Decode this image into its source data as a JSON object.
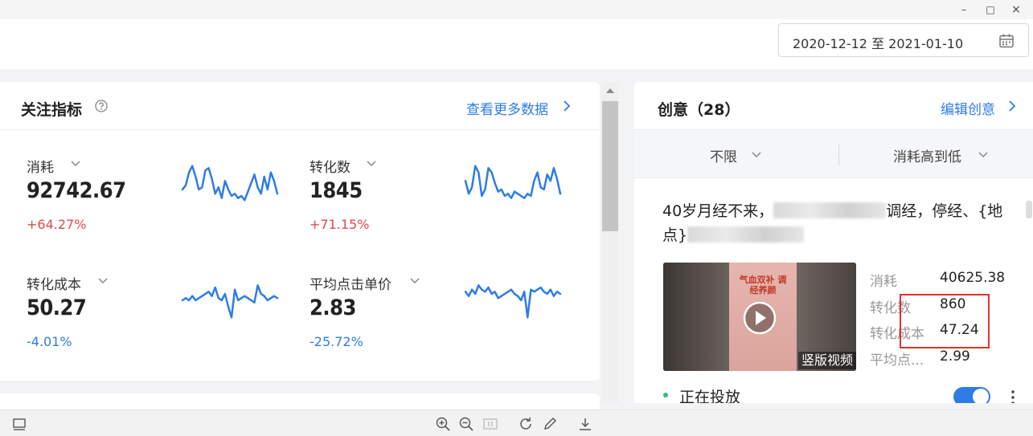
{
  "window": {
    "minimize_glyph": "–",
    "maximize_glyph": "□",
    "close_glyph": "×"
  },
  "header": {
    "date_range": "2020-12-12 至 2021-01-10",
    "calendar_icon": "calendar-icon"
  },
  "focus": {
    "title": "关注指标",
    "help_icon": "question-circle-icon",
    "more_link": "查看更多数据",
    "metrics": [
      {
        "label": "消耗",
        "value": "92742.67",
        "change": "+64.27%",
        "trend": "up",
        "spark": [
          30,
          26,
          14,
          8,
          18,
          30,
          28,
          12,
          10,
          20,
          34,
          28,
          38,
          22,
          30,
          36,
          34,
          38,
          36,
          40,
          32,
          24,
          16,
          28,
          34,
          18,
          30,
          14,
          22,
          34
        ]
      },
      {
        "label": "转化数",
        "value": "1845",
        "change": "+71.15%",
        "trend": "up",
        "spark": [
          22,
          34,
          28,
          8,
          14,
          36,
          30,
          10,
          14,
          24,
          32,
          30,
          36,
          34,
          38,
          32,
          34,
          36,
          38,
          34,
          36,
          22,
          14,
          28,
          30,
          16,
          22,
          10,
          20,
          34
        ]
      },
      {
        "label": "转化成本",
        "value": "50.27",
        "change": "-4.01%",
        "trend": "down",
        "spark": [
          24,
          22,
          24,
          20,
          24,
          22,
          20,
          18,
          16,
          20,
          12,
          22,
          24,
          18,
          30,
          40,
          14,
          24,
          22,
          20,
          22,
          24,
          26,
          10,
          18,
          20,
          24,
          22,
          20,
          22
        ]
      },
      {
        "label": "平均点击单价",
        "value": "2.83",
        "change": "-25.72%",
        "trend": "down",
        "spark": [
          16,
          20,
          14,
          18,
          10,
          14,
          16,
          12,
          18,
          16,
          22,
          20,
          18,
          16,
          14,
          18,
          20,
          24,
          16,
          40,
          14,
          16,
          14,
          12,
          16,
          18,
          14,
          20,
          16,
          18
        ]
      }
    ]
  },
  "creative": {
    "title": "创意（28）",
    "edit_link": "编辑创意",
    "filters": {
      "scope": "不限",
      "sort": "消耗高到低"
    },
    "ad": {
      "title_start": "40岁月经不来，",
      "title_mid": "调经，停经、{地",
      "title_line2_start": "点}",
      "thumbnail_caption": "气血双补 调经养颜",
      "badge": "竖版视频",
      "stats": [
        {
          "label": "消耗",
          "value": "40625.38"
        },
        {
          "label": "转化数",
          "value": "860"
        },
        {
          "label": "转化成本",
          "value": "47.24"
        },
        {
          "label": "平均点...",
          "value": "2.99"
        }
      ],
      "status": "正在投放",
      "enabled": true
    }
  },
  "colors": {
    "accent": "#2f7ce5",
    "up": "#e5484d",
    "down": "#2f7ce5",
    "highlight": "#e0332d",
    "spark": "#2f7ce5"
  }
}
